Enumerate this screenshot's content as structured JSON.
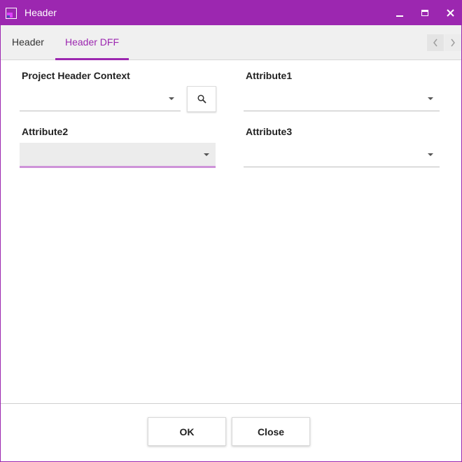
{
  "window": {
    "title": "Header",
    "accent_color": "#9c27b0",
    "icons": [
      "app-icon",
      "minimize-icon",
      "maximize-icon",
      "close-icon"
    ]
  },
  "tabs": [
    {
      "label": "Header",
      "active": false
    },
    {
      "label": "Header DFF",
      "active": true
    }
  ],
  "tab_nav": {
    "prev_icon": "chevron-left-icon",
    "next_icon": "chevron-right-icon"
  },
  "form": {
    "project_header_context": {
      "label": "Project Header Context",
      "value": ""
    },
    "attribute1": {
      "label": "Attribute1",
      "value": ""
    },
    "attribute2": {
      "label": "Attribute2",
      "value": "",
      "focused": true
    },
    "attribute3": {
      "label": "Attribute3",
      "value": ""
    },
    "search_icon": "search-icon"
  },
  "footer": {
    "ok_label": "OK",
    "close_label": "Close"
  }
}
